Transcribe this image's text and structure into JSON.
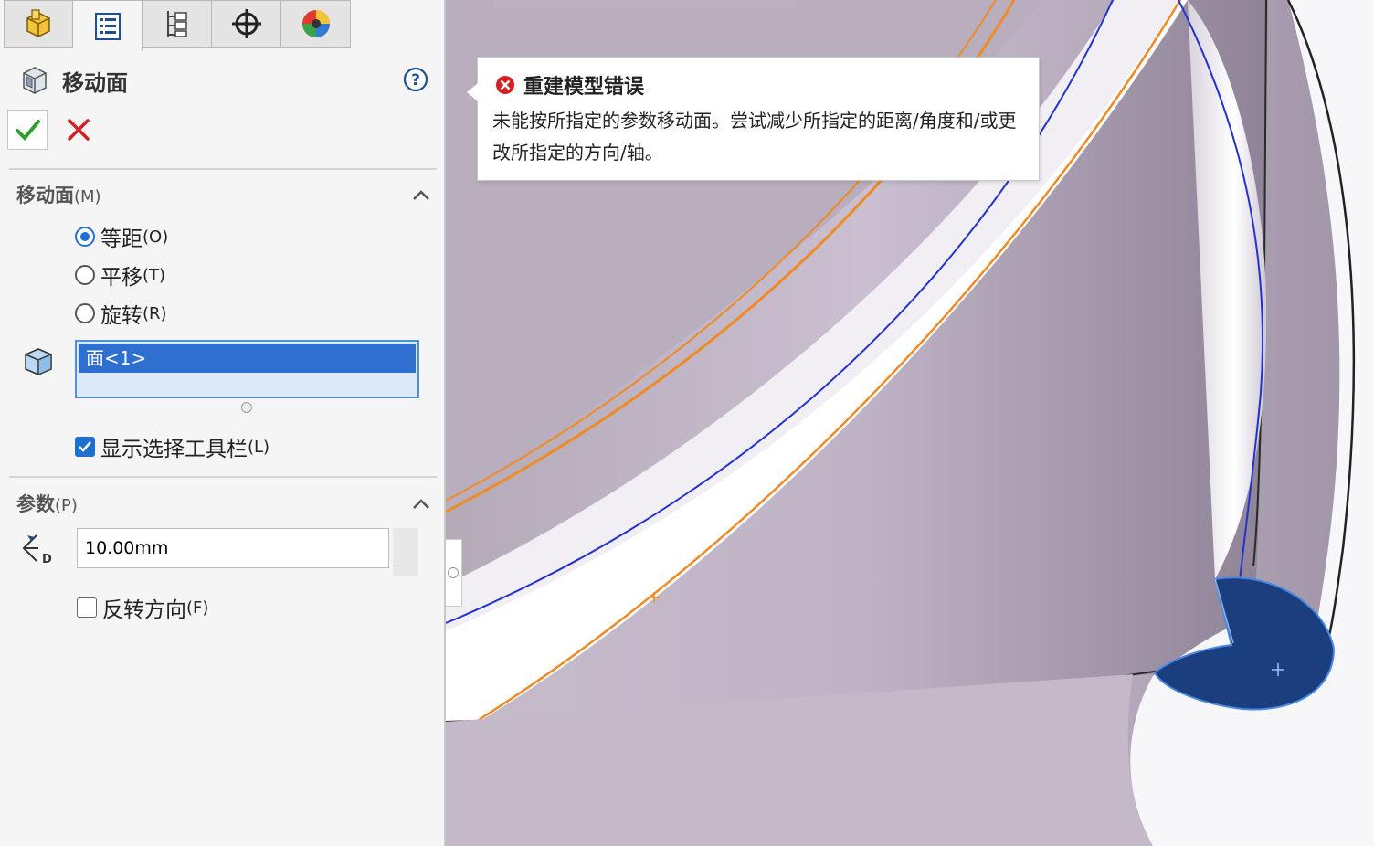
{
  "panel": {
    "tabs": [
      {
        "icon": "feature-manager-icon"
      },
      {
        "icon": "property-manager-icon"
      },
      {
        "icon": "configuration-manager-icon"
      },
      {
        "icon": "dimxpert-icon"
      },
      {
        "icon": "display-manager-icon"
      }
    ],
    "title": "移动面",
    "sections": {
      "move_face": {
        "title": "移动面",
        "shortcut": "(M)",
        "options": [
          {
            "label": "等距",
            "key": "(O)",
            "selected": true
          },
          {
            "label": "平移",
            "key": "(T)",
            "selected": false
          },
          {
            "label": "旋转",
            "key": "(R)",
            "selected": false
          }
        ],
        "face_selection": "面<1>",
        "show_toolbar": {
          "label": "显示选择工具栏",
          "key": "(L)",
          "checked": true
        }
      },
      "parameters": {
        "title": "参数",
        "shortcut": "(P)",
        "distance": "10.00mm",
        "distance_icon_letter": "D",
        "reverse": {
          "label": "反转方向",
          "key": "(F)",
          "checked": false
        }
      }
    }
  },
  "tooltip": {
    "title": "重建模型错误",
    "message": "未能按所指定的参数移动面。尝试减少所指定的距离/角度和/或更改所指定的方向/轴。"
  },
  "colors": {
    "accent": "#1f6fd1",
    "error": "#d42020",
    "ok": "#2e9e2e",
    "model_surface": "#bdb2c4",
    "edge_highlight": "#f08a24",
    "selected_face": "#1b3f7e"
  }
}
